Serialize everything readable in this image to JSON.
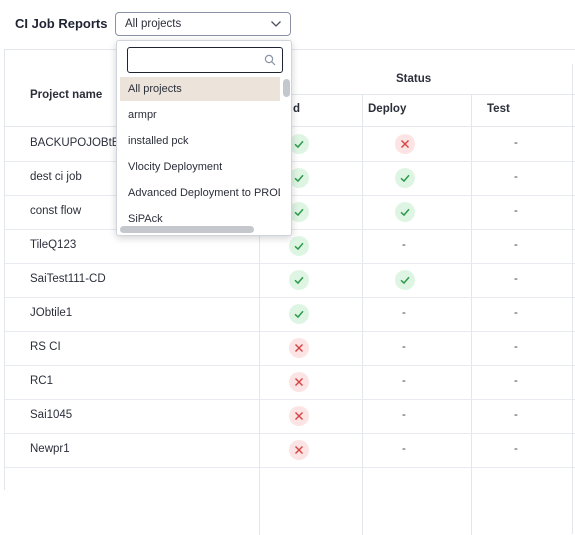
{
  "header": {
    "title": "CI Job Reports",
    "project_select": {
      "value": "All projects",
      "icon": "chevron-down-icon"
    }
  },
  "table": {
    "columns": {
      "project_name": "Project name",
      "status_group": "Status",
      "build": "d",
      "deploy": "Deploy",
      "test": "Test"
    },
    "rows": [
      {
        "name": "BACKUPOJOBtEST",
        "build": "success",
        "deploy": "failure",
        "test": "-"
      },
      {
        "name": "dest ci job",
        "build": "success",
        "deploy": "success",
        "test": "-"
      },
      {
        "name": "const flow",
        "build": "success",
        "deploy": "success",
        "test": "-"
      },
      {
        "name": "TileQ123",
        "build": "success",
        "deploy": "-",
        "test": "-"
      },
      {
        "name": "SaiTest111-CD",
        "build": "success",
        "deploy": "success",
        "test": "-"
      },
      {
        "name": "JObtile1",
        "build": "success",
        "deploy": "-",
        "test": "-"
      },
      {
        "name": "RS CI",
        "build": "failure",
        "deploy": "-",
        "test": "-"
      },
      {
        "name": "RC1",
        "build": "failure",
        "deploy": "-",
        "test": "-"
      },
      {
        "name": "Sai1045",
        "build": "failure",
        "deploy": "-",
        "test": "-"
      },
      {
        "name": "Newpr1",
        "build": "failure",
        "deploy": "-",
        "test": "-"
      }
    ],
    "colors": {
      "success_bg": "#dff5e4",
      "success_fg": "#2e9b4a",
      "failure_bg": "#fde4e4",
      "failure_fg": "#d64545"
    }
  },
  "dropdown": {
    "search_value": "",
    "search_icon": "search-icon",
    "selected_index": 0,
    "items": [
      "All projects",
      "armpr",
      "installed pck",
      "Vlocity Deployment",
      "Advanced Deployment to PROD",
      "SiPAck"
    ]
  }
}
